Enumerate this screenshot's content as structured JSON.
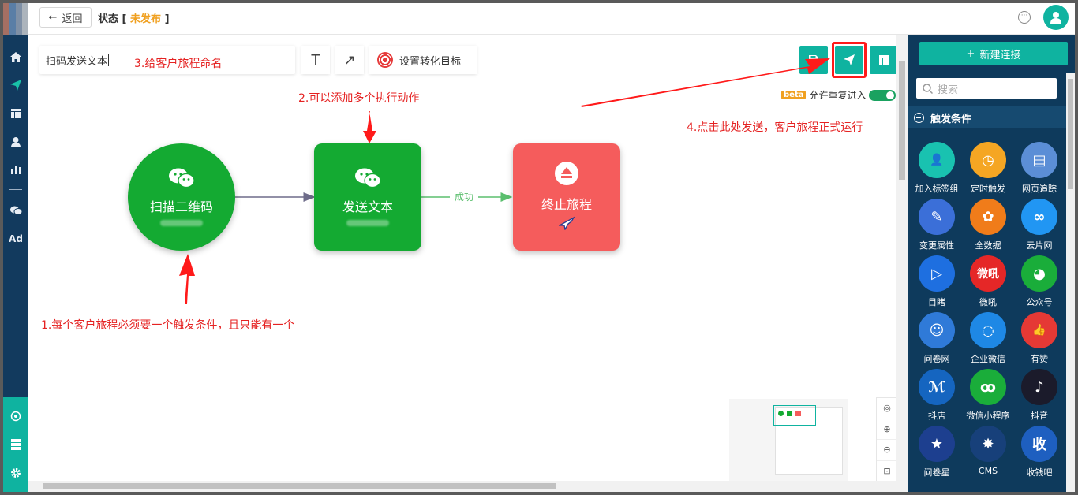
{
  "topbar": {
    "back_label": "返回",
    "status_label": "状态",
    "status_open": "[",
    "status_value": "未发布",
    "status_close": "]"
  },
  "nav": {
    "items": [
      "home-icon",
      "send-icon",
      "layout-icon",
      "user-icon",
      "chart-icon",
      "wechat-icon"
    ],
    "ad_label": "Ad",
    "bottom": [
      "target-icon",
      "server-icon",
      "gear-icon"
    ]
  },
  "toolbar": {
    "journey_name": "扫码发送文本",
    "text_tool": "T",
    "arrow_tool": "↗",
    "goal_label": "设置转化目标",
    "beta_label": "beta",
    "repeat_label": "允许重复进入",
    "repeat_enabled": true
  },
  "flow": {
    "nodes": [
      {
        "id": "trigger",
        "title": "扫描二维码",
        "color": "#14aa32",
        "icon": "wechat-icon"
      },
      {
        "id": "action",
        "title": "发送文本",
        "color": "#14aa32",
        "icon": "wechat-icon"
      },
      {
        "id": "end",
        "title": "终止旅程",
        "color": "#f55c5c",
        "icon": "eject-icon"
      }
    ],
    "edge_label": "成功"
  },
  "annotations": {
    "a1": "1.每个客户旅程必须要一个触发条件，且只能有一个",
    "a2": "2.可以添加多个执行动作",
    "a3": "3.给客户旅程命名",
    "a4": "4.点击此处发送，客户旅程正式运行"
  },
  "panel": {
    "new_connection": "新建连接",
    "search_placeholder": "搜索",
    "section_title": "触发条件",
    "tiles": [
      {
        "label": "加入标签组",
        "color": "#19c2b0",
        "glyph": "👤"
      },
      {
        "label": "定时触发",
        "color": "#f5a623",
        "glyph": "◷"
      },
      {
        "label": "网页追踪",
        "color": "#5b8ed6",
        "glyph": "▤"
      },
      {
        "label": "变更属性",
        "color": "#3b6fd8",
        "glyph": "✎"
      },
      {
        "label": "全数据",
        "color": "#f07c1a",
        "glyph": "✿"
      },
      {
        "label": "云片网",
        "color": "#2196f3",
        "glyph": "∞"
      },
      {
        "label": "目睹",
        "color": "#1e6fe0",
        "glyph": "▷"
      },
      {
        "label": "微吼",
        "color": "#e52727",
        "glyph": "微吼"
      },
      {
        "label": "公众号",
        "color": "#1aad3a",
        "glyph": "◕"
      },
      {
        "label": "问卷网",
        "color": "#2f7ad8",
        "glyph": "☺"
      },
      {
        "label": "企业微信",
        "color": "#1e88e5",
        "glyph": "◌"
      },
      {
        "label": "有赞",
        "color": "#e53935",
        "glyph": "👍"
      },
      {
        "label": "抖店",
        "color": "#1565c0",
        "glyph": "ℳ"
      },
      {
        "label": "微信小程序",
        "color": "#1aad3a",
        "glyph": "ꝏ"
      },
      {
        "label": "抖音",
        "color": "#1b1b2b",
        "glyph": "♪"
      },
      {
        "label": "问卷星",
        "color": "#1d3f8f",
        "glyph": "★"
      },
      {
        "label": "CMS",
        "color": "#17407a",
        "glyph": "✸"
      },
      {
        "label": "收钱吧",
        "color": "#1e5fc0",
        "glyph": "收"
      }
    ]
  },
  "colors": {
    "accent": "#0fb3a0",
    "nav_bg": "#123a5e",
    "panel_bg": "#0e3a5c",
    "annotation": "#e52222",
    "unpublished": "#f0a020"
  }
}
